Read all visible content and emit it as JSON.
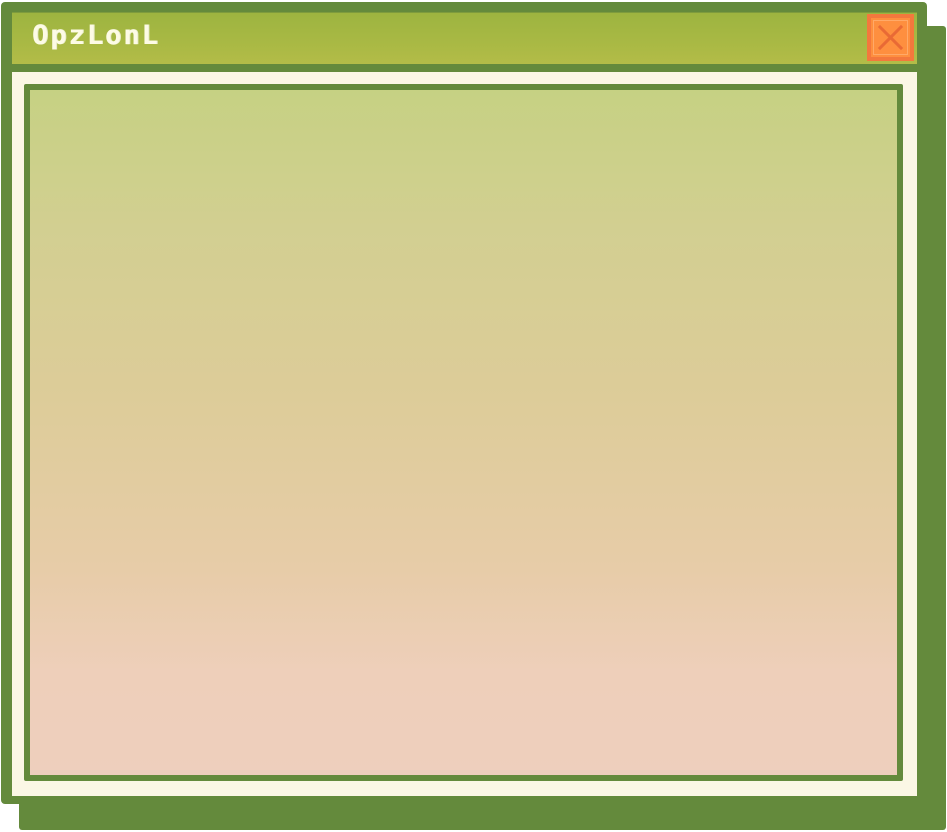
{
  "window": {
    "title": "OpzLonL",
    "close_icon": "close-icon",
    "colors": {
      "frame": "#648a3c",
      "titlebar": "#a9b944",
      "title_text": "#fdfbe6",
      "close_button": "#fe8f3f",
      "inner_border": "#fbf7e5",
      "content_top": "#c6d183",
      "content_bottom": "#eecfbd"
    }
  }
}
